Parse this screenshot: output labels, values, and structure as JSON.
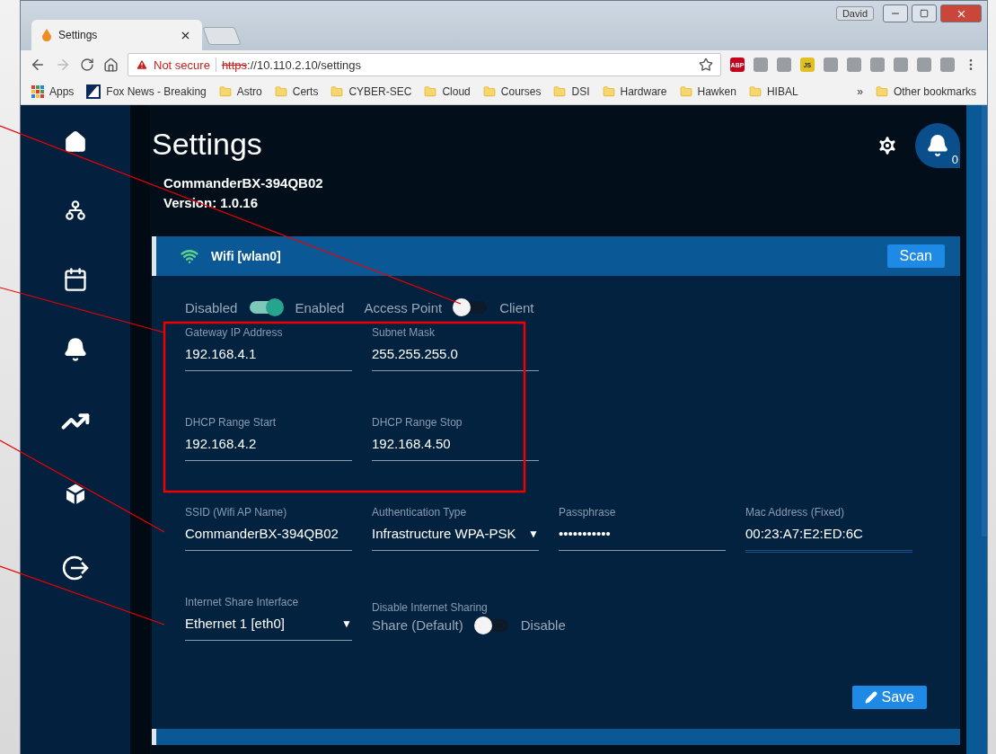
{
  "browser": {
    "user": "David",
    "tab": {
      "title": "Settings"
    },
    "address": {
      "warning": "Not secure",
      "scheme": "https",
      "rest": "://10.110.2.10/settings"
    },
    "extensions": [
      {
        "kind": "abp",
        "label": "ABP"
      },
      {
        "kind": "plain"
      },
      {
        "kind": "plain"
      },
      {
        "kind": "js",
        "label": "JS"
      },
      {
        "kind": "plain"
      },
      {
        "kind": "plain"
      },
      {
        "kind": "plain"
      },
      {
        "kind": "plain"
      },
      {
        "kind": "plain"
      },
      {
        "kind": "plain"
      }
    ],
    "bookmarks": [
      {
        "kind": "apps",
        "label": "Apps"
      },
      {
        "kind": "site",
        "label": "Fox News - Breaking"
      },
      {
        "kind": "folder",
        "label": "Astro"
      },
      {
        "kind": "folder",
        "label": "Certs"
      },
      {
        "kind": "folder",
        "label": "CYBER-SEC"
      },
      {
        "kind": "folder",
        "label": "Cloud"
      },
      {
        "kind": "folder",
        "label": "Courses"
      },
      {
        "kind": "folder",
        "label": "DSI"
      },
      {
        "kind": "folder",
        "label": "Hardware"
      },
      {
        "kind": "folder",
        "label": "Hawken"
      },
      {
        "kind": "folder",
        "label": "HIBAL"
      }
    ],
    "more": "»",
    "other": "Other bookmarks"
  },
  "page": {
    "title": "Settings",
    "device": "CommanderBX-394QB02",
    "version": "Version: 1.0.16",
    "notifications": "0"
  },
  "card": {
    "title": "Wifi [wlan0]",
    "scan": "Scan",
    "toggles": [
      {
        "off_label": "Disabled",
        "on_label": "Enabled",
        "on": true
      },
      {
        "off_label": "Access Point",
        "on_label": "Client",
        "on": false
      }
    ],
    "field_rows": [
      [
        {
          "kind": "text",
          "label": "Gateway IP Address",
          "value": "192.168.4.1"
        },
        {
          "kind": "text",
          "label": "Subnet Mask",
          "value": "255.255.255.0"
        }
      ],
      [
        {
          "kind": "text",
          "label": "DHCP Range Start",
          "value": "192.168.4.2"
        },
        {
          "kind": "text",
          "label": "DHCP Range Stop",
          "value": "192.168.4.50"
        }
      ],
      [
        {
          "kind": "text",
          "label": "SSID (Wifi AP Name)",
          "value": "CommanderBX-394QB02"
        },
        {
          "kind": "select",
          "label": "Authentication Type",
          "value": "Infrastructure WPA-PSK",
          "arrow": "▼"
        },
        {
          "kind": "text",
          "label": "Passphrase",
          "value": "•••••••••••"
        },
        {
          "kind": "readonly",
          "label": "Mac Address (Fixed)",
          "value": "00:23:A7:E2:ED:6C"
        }
      ]
    ],
    "share": {
      "label": "Internet Share Interface",
      "value": "Ethernet 1 [eth0]",
      "arrow": "▼"
    },
    "sharing": {
      "title": "Disable Internet Sharing",
      "off_label": "Share (Default)",
      "on_label": "Disable",
      "on": false
    },
    "save": "Save"
  }
}
